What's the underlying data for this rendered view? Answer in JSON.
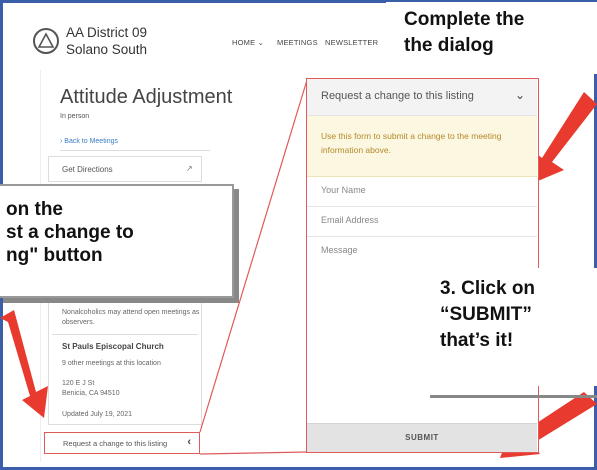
{
  "site": {
    "name_line1": "AA District 09",
    "name_line2": "Solano South",
    "nav": [
      "HOME",
      "MEETINGS",
      "NEWSLETTER"
    ]
  },
  "meeting": {
    "title": "Attitude Adjustment",
    "type": "In person",
    "back_link": "Back to Meetings",
    "get_directions": "Get Directions",
    "open_note": "Nonalcoholics may attend open meetings as observers.",
    "location_name": "St Pauls Episcopal Church",
    "other_meetings": "9 other meetings at this location",
    "address_line1": "120 E J St",
    "address_line2": "Benicia, CA 94510",
    "updated": "Updated July 19, 2021",
    "request_button": "Request a change to this listing"
  },
  "dialog": {
    "title": "Request a change to this listing",
    "info": "Use this form to submit a change to the meeting information above.",
    "name_placeholder": "Your Name",
    "email_placeholder": "Email Address",
    "message_placeholder": "Message",
    "submit_label": "SUBMIT"
  },
  "callouts": {
    "step1_line1": "on the",
    "step1_line2": "st a change to",
    "step1_line3": "ng\" button",
    "step2_line1": "Complete the",
    "step2_line2": "the dialog",
    "step3_line1": "3. Click on",
    "step3_line2": "“SUBMIT”",
    "step3_line3": "that’s it!"
  },
  "colors": {
    "frame": "#3b5ea8",
    "arrow": "#e83a2e",
    "highlight": "#e05a5a",
    "info_bg": "#fcf7e1"
  }
}
